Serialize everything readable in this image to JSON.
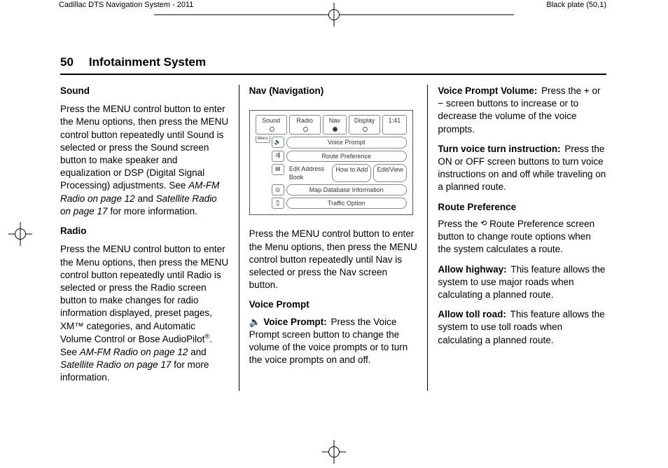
{
  "header": {
    "left": "Cadillac DTS Navigation System - 2011",
    "right": "Black plate (50,1)"
  },
  "page": {
    "number": "50",
    "title": "Infotainment System"
  },
  "col1": {
    "sound_h": "Sound",
    "sound_p": "Press the MENU control button to enter the Menu options, then press the MENU control button repeatedly until Sound is selected or press the Sound screen button to make speaker and equalization or DSP (Digital Signal Processing) adjustments. See ",
    "sound_ref1": "AM-FM Radio on page 12",
    "sound_mid": " and ",
    "sound_ref2": "Satellite Radio on page 17",
    "sound_end": " for more information.",
    "radio_h": "Radio",
    "radio_p1": "Press the MENU control button to enter the Menu options, then press the MENU control button repeatedly until Radio is selected or press the Radio screen button to make changes for radio information displayed, preset pages, XM™ categories, and Automatic Volume Control or Bose AudioPilot",
    "radio_reg": "®",
    "radio_p2": ". See ",
    "radio_ref1": "AM-FM Radio on page 12",
    "radio_mid": " and ",
    "radio_ref2": "Satellite Radio on page 17",
    "radio_end": " for more information."
  },
  "col2": {
    "nav_h": "Nav (Navigation)",
    "fig": {
      "tabs": {
        "sound": "Sound",
        "radio": "Radio",
        "nav": "Nav",
        "display": "Display",
        "time": "1:41"
      },
      "menu": "Menu",
      "rows": {
        "voice_prompt": "Voice Prompt",
        "route_pref": "Route Preference",
        "edit_book": "Edit Address Book",
        "how_to_add": "How to Add",
        "edit_view": "Edit/View",
        "map_db": "Map Database Information",
        "traffic": "Traffic Option"
      }
    },
    "nav_p": "Press the MENU control button to enter the Menu options, then press the MENU control button repeatedly until Nav is selected or press the Nav screen button.",
    "vp_h": "Voice Prompt",
    "vp_icon": "🔈",
    "vp_label": "Voice Prompt:",
    "vp_body": "Press the Voice Prompt screen button to change the volume of the voice prompts or to turn the voice prompts on and off."
  },
  "col3": {
    "vpv_label": "Voice Prompt Volume:",
    "vpv_body": "Press the + or − screen buttons to increase or to decrease the volume of the voice prompts.",
    "tvti_label": "Turn voice turn instruction:",
    "tvti_body": "Press the ON or OFF screen buttons to turn voice instructions on and off while traveling on a planned route.",
    "rp_h": "Route Preference",
    "rp_pre": "Press the ",
    "rp_post": " Route Preference screen button to change route options when the system calculates a route.",
    "ah_label": "Allow highway:",
    "ah_body": "This feature allows the system to use major roads when calculating a planned route.",
    "atr_label": "Allow toll road:",
    "atr_body": "This feature allows the system to use toll roads when calculating a planned route."
  }
}
